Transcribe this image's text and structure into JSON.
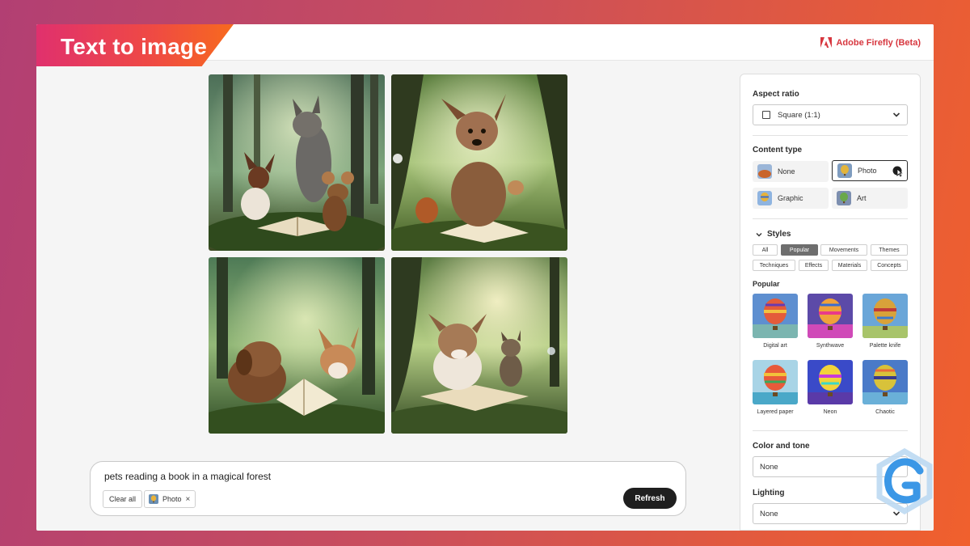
{
  "header": {
    "title": "Text to image",
    "brand": "Adobe Firefly (Beta)"
  },
  "prompt": {
    "text": "pets reading a book in a magical forest",
    "clear_label": "Clear all",
    "chip_label": "Photo",
    "chip_remove": "×",
    "refresh_label": "Refresh"
  },
  "panel": {
    "aspect_ratio": {
      "label": "Aspect ratio",
      "value": "Square (1:1)"
    },
    "content_type": {
      "label": "Content type",
      "options": [
        "None",
        "Photo",
        "Graphic",
        "Art"
      ],
      "selected": "Photo"
    },
    "styles": {
      "label": "Styles",
      "tabs": [
        "All",
        "Popular",
        "Movements",
        "Themes",
        "Techniques",
        "Effects",
        "Materials",
        "Concepts"
      ],
      "active_tab": "Popular",
      "section_label": "Popular",
      "items": [
        "Digital art",
        "Synthwave",
        "Palette knife",
        "Layered paper",
        "Neon",
        "Chaotic"
      ]
    },
    "color_tone": {
      "label": "Color and tone",
      "value": "None"
    },
    "lighting": {
      "label": "Lighting",
      "value": "None"
    }
  },
  "colors": {
    "brand_red": "#d7373f",
    "banner_gradient_start": "#e0306e",
    "banner_gradient_end": "#f76a1e",
    "refresh_bg": "#1f1f1f",
    "watermark_blue": "#3b97e6"
  },
  "icons": {
    "brand": "adobe-logo-icon",
    "aspect": "square-icon",
    "dropdown": "chevron-down-icon",
    "styles_toggle": "chevron-down-icon",
    "chip_remove": "close-icon",
    "cursor": "pointer-cursor-icon",
    "watermark": "g-logo-icon"
  }
}
